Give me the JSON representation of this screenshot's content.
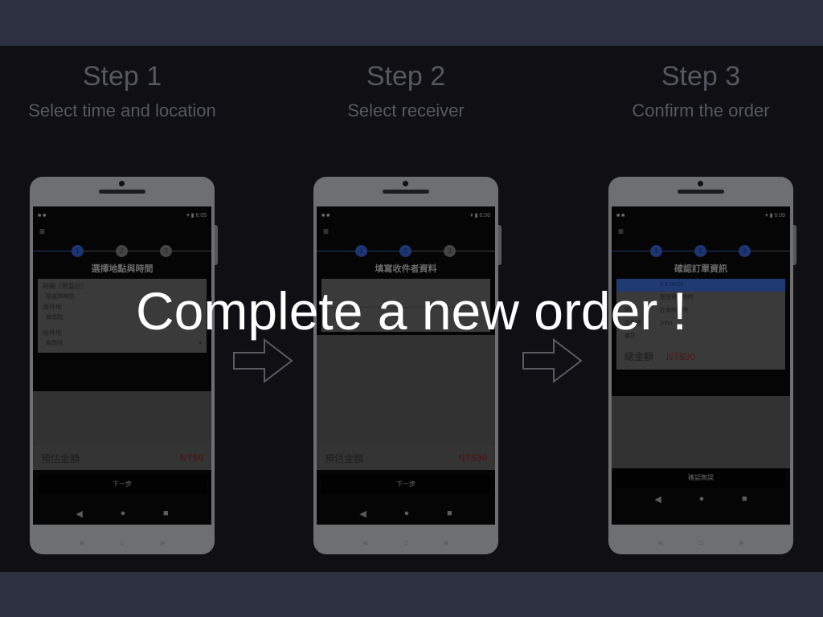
{
  "steps": [
    {
      "title": "Step 1",
      "subtitle": "Select time and location"
    },
    {
      "title": "Step 2",
      "subtitle": "Select receiver"
    },
    {
      "title": "Step 3",
      "subtitle": "Confirm the order"
    }
  ],
  "overlay": {
    "text": "Complete a new order !"
  },
  "phone1": {
    "status_left": "■ ■",
    "status_right": "▾ ▮ 6:05",
    "screen_title": "選擇地點與時間",
    "step_numbers": [
      "1",
      "2",
      "3"
    ],
    "fields": {
      "time_label": "時間（限當日）",
      "time_value": "請選擇時間",
      "sender_label": "寄件地",
      "sender_value": "商學院",
      "receiver_label": "收件地",
      "receiver_value": "商學院"
    },
    "price_label": "預估金額",
    "price_value": "NT$0",
    "next_button": "下一步"
  },
  "phone2": {
    "status_left": "■ ■",
    "status_right": "▾ ▮ 6:06",
    "screen_title": "填寫收件者資料",
    "step_numbers": [
      "1",
      "2",
      "3"
    ],
    "price_label": "預估金額",
    "price_value": "NT$30",
    "next_button": "下一步"
  },
  "phone3": {
    "status_left": "■ ■",
    "status_right": "▾ ▮ 6:09",
    "screen_title": "確認訂單資訊",
    "step_numbers": [
      "1",
      "2",
      "3"
    ],
    "date_row": "5-1 06:00",
    "row_building_value": "管理資訊學院",
    "row_place_label": "地點",
    "row_place_value": "社會科學院",
    "row_receiver_label": "收件者",
    "row_receiver_value": "John",
    "row_note_label": "備註",
    "total_label": "總金額",
    "total_value": "NT$30",
    "confirm_button": "確認無誤"
  },
  "nav_icons": [
    "◀",
    "●",
    "■"
  ],
  "phone_buttons": [
    "«",
    "○",
    "»"
  ]
}
